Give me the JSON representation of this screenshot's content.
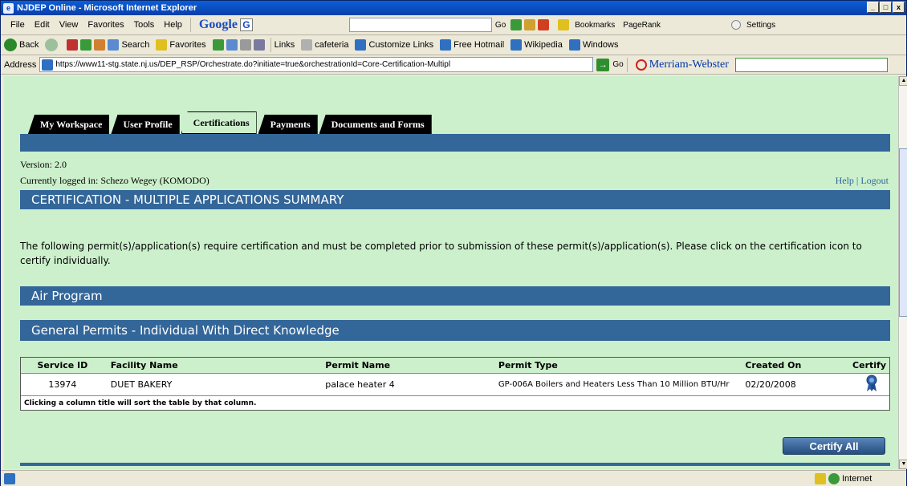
{
  "window": {
    "title": "NJDEP Online - Microsoft Internet Explorer",
    "min": "_",
    "max": "□",
    "close": "x"
  },
  "menu": [
    "File",
    "Edit",
    "View",
    "Favorites",
    "Tools",
    "Help"
  ],
  "google": {
    "logo": "Google",
    "go": "Go",
    "bookmarks": "Bookmarks",
    "pagerank": "PageRank",
    "settings": "Settings"
  },
  "nav": {
    "back": "Back",
    "search": "Search",
    "favorites": "Favorites",
    "links": "Links",
    "link_items": [
      "cafeteria",
      "Customize Links",
      "Free Hotmail",
      "Wikipedia",
      "Windows"
    ]
  },
  "address": {
    "label": "Address",
    "url": "https://www11-stg.state.nj.us/DEP_RSP/Orchestrate.do?initiate=true&orchestrationId=Core-Certification-Multipl",
    "go": "Go",
    "mw": "Merriam-Webster"
  },
  "tabs": [
    "My Workspace",
    "User Profile",
    "Certifications",
    "Payments",
    "Documents and Forms"
  ],
  "page": {
    "version": "Version: 2.0",
    "logged": "Currently logged in: Schezo Wegey (KOMODO)",
    "help": "Help",
    "logout": "Logout",
    "heading": "CERTIFICATION - MULTIPLE APPLICATIONS SUMMARY",
    "intro": "The following permit(s)/application(s) require certification and must be completed prior to submission of these permit(s)/application(s). Please click on the certification icon to certify individually.",
    "section1": "Air Program",
    "section2": "General Permits - Individual With Direct Knowledge",
    "columns": [
      "Service ID",
      "Facility Name",
      "Permit Name",
      "Permit Type",
      "Created On",
      "Certify"
    ],
    "rows": [
      [
        "13974",
        "DUET BAKERY",
        "palace heater 4",
        "GP-006A Boilers and Heaters Less Than 10 Million BTU/Hr",
        "02/20/2008",
        "ribbon-icon"
      ]
    ],
    "table_note": "Clicking a column title will sort the table by that column.",
    "certify_all": "Certify All"
  },
  "status": {
    "zone": "Internet"
  }
}
